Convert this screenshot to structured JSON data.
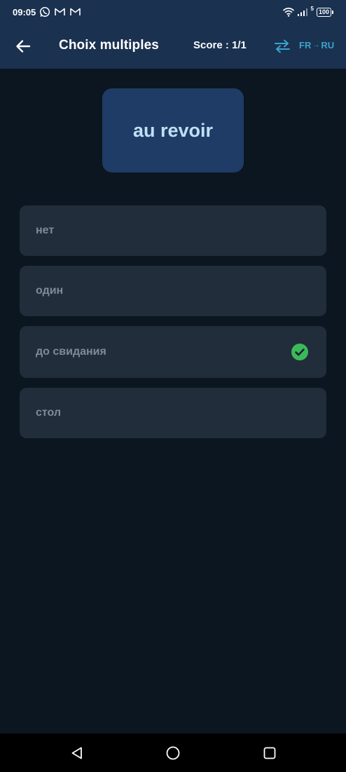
{
  "status_bar": {
    "time": "09:05",
    "network_type": "5",
    "battery": "100"
  },
  "app_bar": {
    "title": "Choix multiples",
    "score": "Score : 1/1",
    "lang_from": "FR",
    "lang_to": "RU"
  },
  "question": {
    "word": "au revoir"
  },
  "options": [
    {
      "label": "нет",
      "correct": false
    },
    {
      "label": "один",
      "correct": false
    },
    {
      "label": "до свидания",
      "correct": true
    },
    {
      "label": "стол",
      "correct": false
    }
  ],
  "colors": {
    "app_bar_bg": "#1a3150",
    "background": "#0c1620",
    "card_bg": "#1f3c66",
    "word_text": "#bfe0f5",
    "option_bg": "#212d3a",
    "option_text": "#7e8b98",
    "accent": "#3aa3c8",
    "correct_check": "#3cb95a"
  }
}
